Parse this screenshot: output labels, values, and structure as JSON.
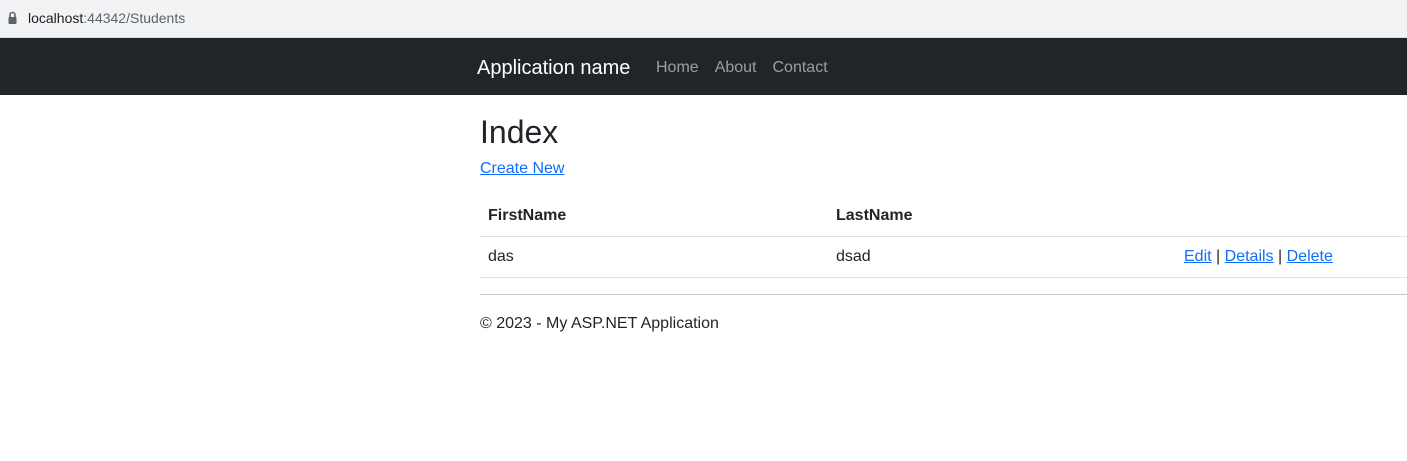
{
  "browser": {
    "url_host": "localhost",
    "url_rest": ":44342/Students",
    "lock_icon": "lock-icon"
  },
  "navbar": {
    "brand": "Application name",
    "links": [
      "Home",
      "About",
      "Contact"
    ]
  },
  "page": {
    "title": "Index",
    "create_link": "Create New"
  },
  "table": {
    "headers": [
      "FirstName",
      "LastName"
    ],
    "rows": [
      {
        "first_name": "das",
        "last_name": "dsad"
      }
    ],
    "actions": {
      "edit": "Edit",
      "details": "Details",
      "delete": "Delete",
      "separator": "|"
    }
  },
  "footer": {
    "text": "© 2023 - My ASP.NET Application"
  },
  "colors": {
    "navbar_bg": "#212529",
    "link": "#0d6efd"
  }
}
